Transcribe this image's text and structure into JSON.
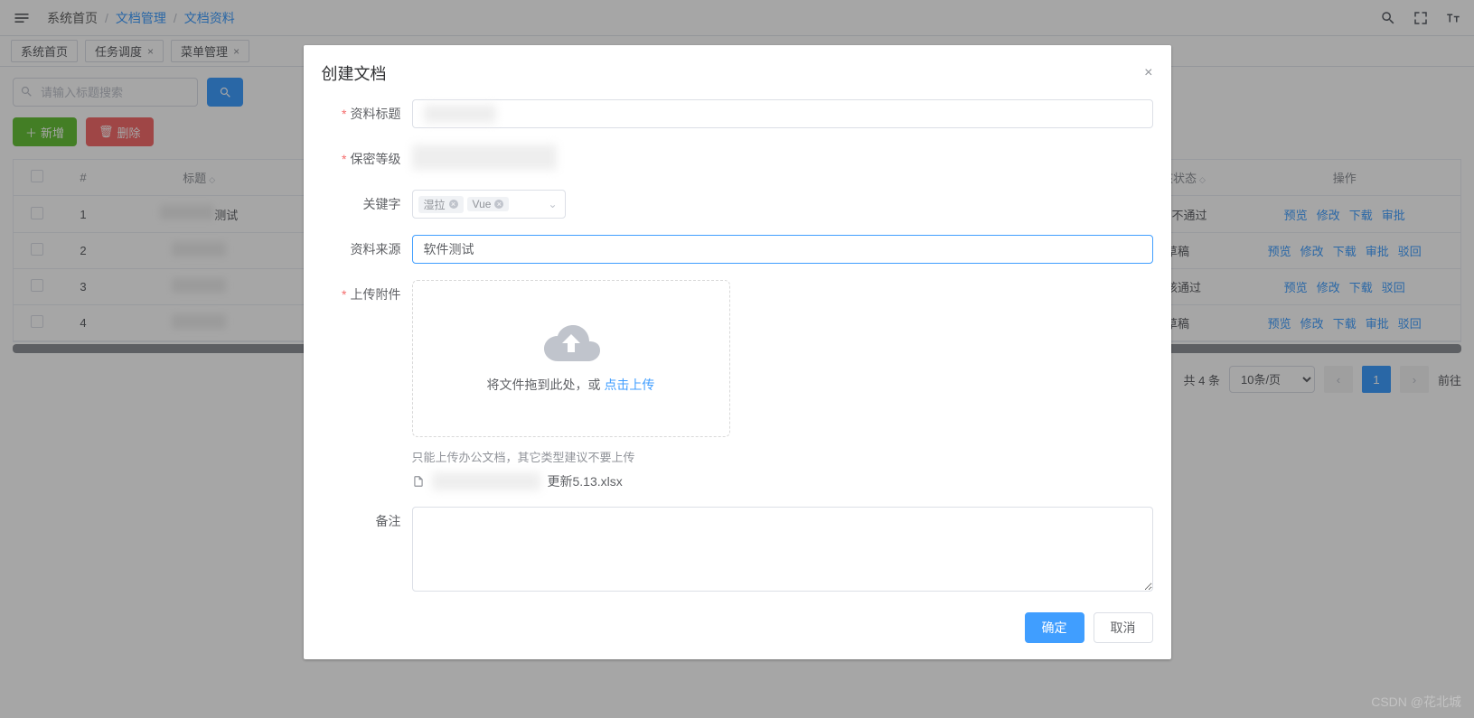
{
  "breadcrumb": {
    "home": "系统首页",
    "sep": "/",
    "mgmt": "文档管理",
    "docs": "文档资料"
  },
  "tabs": [
    {
      "label": "系统首页",
      "closable": false
    },
    {
      "label": "任务调度",
      "closable": true
    },
    {
      "label": "菜单管理",
      "closable": true
    }
  ],
  "search": {
    "placeholder": "请输入标题搜索"
  },
  "actions": {
    "add": "新增",
    "delete": "删除"
  },
  "table": {
    "headers": {
      "idx": "#",
      "title": "标题",
      "status": "审核状态",
      "ops": "操作"
    },
    "rows": [
      {
        "idx": "1",
        "title": "测试",
        "status": "审核不通过",
        "ops": [
          "预览",
          "修改",
          "下载",
          "审批"
        ]
      },
      {
        "idx": "2",
        "title": "",
        "status": "草稿",
        "ops": [
          "预览",
          "修改",
          "下载",
          "审批",
          "驳回"
        ]
      },
      {
        "idx": "3",
        "title": "",
        "status": "审核通过",
        "ops": [
          "预览",
          "修改",
          "下载",
          "驳回"
        ]
      },
      {
        "idx": "4",
        "title": "",
        "status": "草稿",
        "ops": [
          "预览",
          "修改",
          "下载",
          "审批",
          "驳回"
        ]
      }
    ]
  },
  "pager": {
    "total": "共 4 条",
    "size": "10条/页",
    "page": "1",
    "goto": "前往"
  },
  "dialog": {
    "title": "创建文档",
    "labels": {
      "docTitle": "资料标题",
      "secret": "保密等级",
      "keywords": "关键字",
      "source": "资料来源",
      "upload": "上传附件",
      "remark": "备注"
    },
    "keywords": [
      "湿拉",
      "Vue"
    ],
    "sourceValue": "软件测试",
    "upload": {
      "text1": "将文件拖到此处，或 ",
      "link": "点击上传",
      "tip": "只能上传办公文档，其它类型建议不要上传"
    },
    "file": {
      "nameSuffix": "更新5.13.xlsx"
    },
    "buttons": {
      "ok": "确定",
      "cancel": "取消"
    }
  },
  "watermark": "CSDN @花北城"
}
